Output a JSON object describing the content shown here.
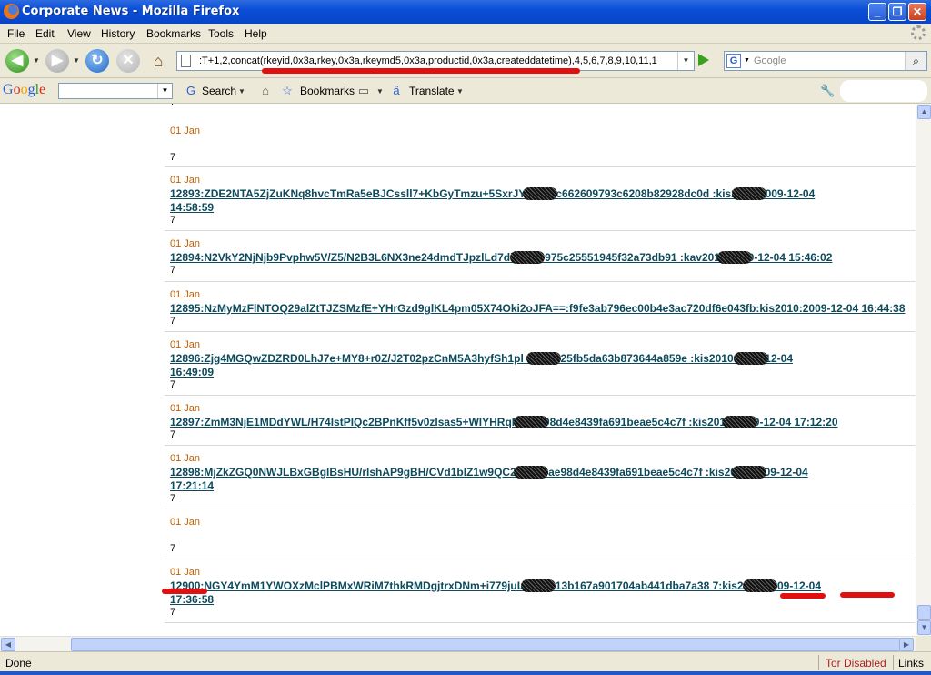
{
  "window": {
    "title": "Corporate News - Mozilla Firefox",
    "min_glyph": "_",
    "max_glyph": "❐",
    "close_glyph": "✕"
  },
  "menu": [
    "File",
    "Edit",
    "View",
    "History",
    "Bookmarks",
    "Tools",
    "Help"
  ],
  "navbar": {
    "url": ":T+1,2,concat(rkeyid,0x3a,rkey,0x3a,rkeymd5,0x3a,productid,0x3a,createddatetime),4,5,6,7,8,9,10,11,1",
    "search_placeholder": "Google",
    "search_engine_glyph": "G"
  },
  "google_toolbar": {
    "logo": "Google",
    "search_label": "Search",
    "bookmarks_label": "Bookmarks",
    "translate_label": "Translate"
  },
  "entries": [
    {
      "date": "",
      "link": "",
      "value": "7"
    },
    {
      "date": "01 Jan",
      "link": "",
      "value": "7"
    },
    {
      "date": "01 Jan",
      "link": "12893:ZDE2NTA5ZjZuKNq8hvcTmRa5eBJCssll7+KbGyTmzu+5SxrJYY        ==:fc662609793c6208b82928dc0d        :kis2010:2009-12-04\n14:58:59",
      "value": "7"
    },
    {
      "date": "01 Jan",
      "link": "12894:N2VkY2NjNjb9Pvphw5V/Z5/N2B3L6NX3ne24dmdTJpzlLd7dl         :6ecb975c25551945f32a73db91         :kav2010:2009-12-04 15:46:02",
      "value": "7"
    },
    {
      "date": "01 Jan",
      "link": "12895:NzMyMzFlNTOQ29alZtTJZSMzfE+YHrGzd9glKL4pm05X74Oki2oJFA==:f9fe3ab796ec00b4e3ac720df6e043fb:kis2010:2009-12-04 16:44:38",
      "value": "7"
    },
    {
      "date": "01 Jan",
      "link": "12896:Zjg4MGQwZDZRD0LhJ7e+MY8+r0Z/J2T02pzCnM5A3hyfSh1pl        :c747825fb5da63b873644a859e        :kis2010:2009-12-04\n16:49:09",
      "value": "7"
    },
    {
      "date": "01 Jan",
      "link": "12897:ZmM3NjE1MDdYWL/H74lstPlQc2BPnKff5v0zlsas5+WlYHRqP        :4ae98d4e8439fa691beae5c4c7f        :kis2010:2009-12-04 17:12:20",
      "value": "7"
    },
    {
      "date": "01 Jan",
      "link": "12898:MjZkZGQ0NWJLBxGBglBsHU/rlshAP9gBH/CVd1blZ1w9QC2q        ==:4ae98d4e8439fa691beae5c4c7f        :kis2010:2009-12-04\n17:21:14",
      "value": "7"
    },
    {
      "date": "01 Jan",
      "link": "",
      "value": "7"
    },
    {
      "date": "01 Jan",
      "link": "12900:NGY4YmM1YWOXzMclPBMxWRiM7thkRMDgjtrxDNm+i779juL4        ==:313b167a901704ab441dba7a38        7:kis2010:2009-12-04\n17:36:58",
      "value": "7"
    }
  ],
  "statusbar": {
    "left": "Done",
    "tor": "Tor Disabled",
    "links": "Links"
  },
  "colors": {
    "date": "#c06000",
    "link": "#0c4a5c",
    "redaction_marker": "#e01010",
    "tor_text": "#b02020"
  }
}
